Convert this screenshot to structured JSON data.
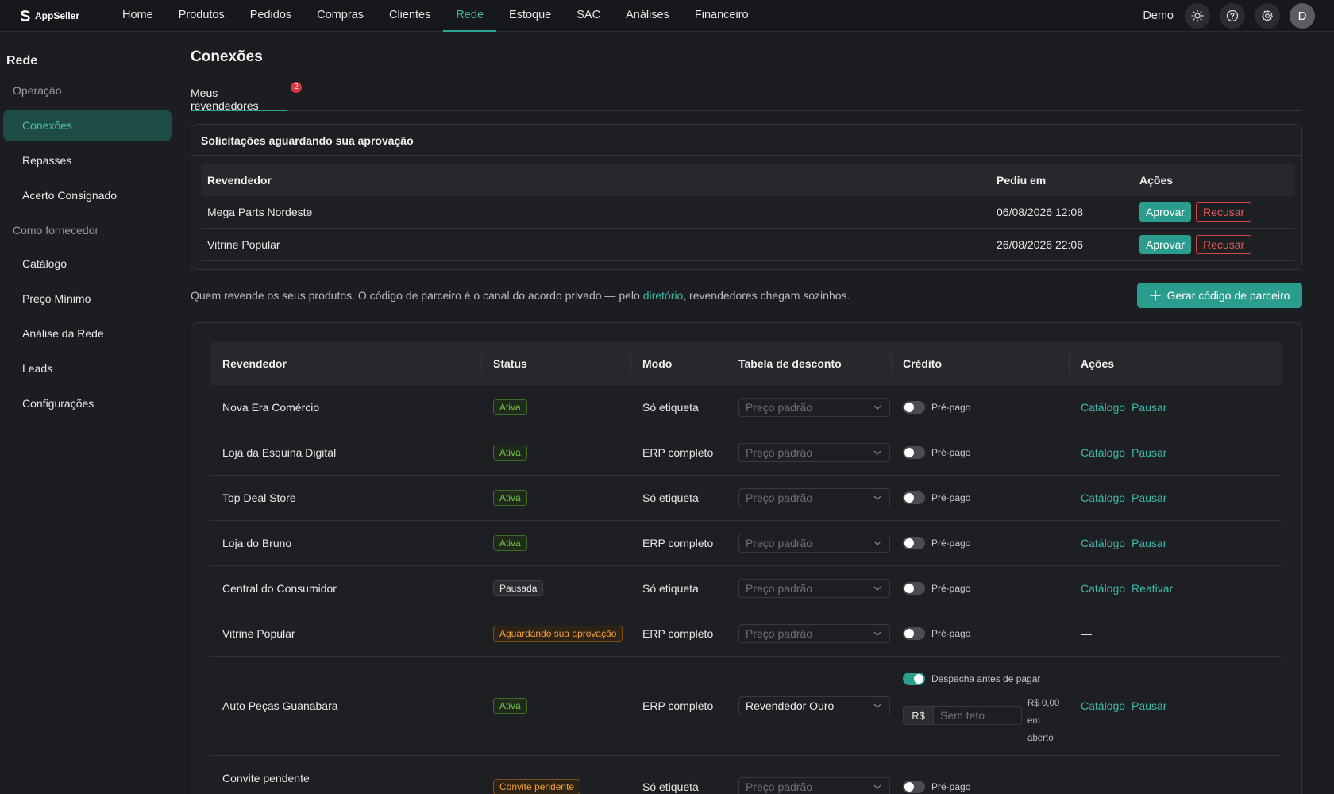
{
  "app": {
    "logo_text": "AppSeller"
  },
  "nav": {
    "items": [
      {
        "label": "Home"
      },
      {
        "label": "Produtos"
      },
      {
        "label": "Pedidos"
      },
      {
        "label": "Compras"
      },
      {
        "label": "Clientes"
      },
      {
        "label": "Rede"
      },
      {
        "label": "Estoque"
      },
      {
        "label": "SAC"
      },
      {
        "label": "Análises"
      },
      {
        "label": "Financeiro"
      }
    ],
    "active": "Rede",
    "user_name": "Demo",
    "avatar_initial": "D",
    "icons": [
      "sun-icon",
      "help-icon",
      "gear-icon"
    ]
  },
  "sidebar": {
    "title": "Rede",
    "section_operacao": "Operação",
    "item_conexoes": "Conexões",
    "item_repasses": "Repasses",
    "item_acerto": "Acerto Consignado",
    "section_fornecedor": "Como fornecedor",
    "item_catalogo": "Catálogo",
    "item_preco": "Preço Mínimo",
    "item_analise": "Análise da Rede",
    "item_leads": "Leads",
    "item_config": "Configurações"
  },
  "page": {
    "title": "Conexões",
    "tab_label": "Meus revendedores",
    "tab_badge": "2"
  },
  "requests": {
    "title": "Solicitações aguardando sua aprovação",
    "headers": {
      "reseller": "Revendedor",
      "requested": "Pediu em",
      "actions": "Ações"
    },
    "approve_label": "Aprovar",
    "refuse_label": "Recusar",
    "rows": [
      {
        "name": "Mega Parts Nordeste",
        "date": "06/08/2026 12:08"
      },
      {
        "name": "Vitrine Popular",
        "date": "26/08/2026 22:06"
      }
    ]
  },
  "info": {
    "text_before": "Quem revende os seus produtos. O código de parceiro é o canal do acordo privado — pelo ",
    "link": "diretório",
    "text_after": ", revendedores chegam sozinhos.",
    "button": "Gerar código de parceiro"
  },
  "resellers": {
    "headers": {
      "reseller": "Revendedor",
      "status": "Status",
      "mode": "Modo",
      "discount": "Tabela de desconto",
      "credit": "Crédito",
      "actions": "Ações"
    },
    "credit_prepaid": "Pré-pago",
    "credit_ship_before": "Despacha antes de pagar",
    "credit_prefix": "R$",
    "credit_placeholder": "Sem teto",
    "credit_open_amount": "R$ 0,00",
    "credit_open_word1": "em",
    "credit_open_word2": "aberto",
    "discount_placeholder": "Preço padrão",
    "action_catalog": "Catálogo",
    "action_pause": "Pausar",
    "action_reactivate": "Reativar",
    "action_none": "—",
    "rows": [
      {
        "name": "Nova Era Comércio",
        "status": "Ativa",
        "status_kind": "green",
        "mode": "Só etiqueta"
      },
      {
        "name": "Loja da Esquina Digital",
        "status": "Ativa",
        "status_kind": "green",
        "mode": "ERP completo"
      },
      {
        "name": "Top Deal Store",
        "status": "Ativa",
        "status_kind": "green",
        "mode": "Só etiqueta"
      },
      {
        "name": "Loja do Bruno",
        "status": "Ativa",
        "status_kind": "green",
        "mode": "ERP completo"
      },
      {
        "name": "Central do Consumidor",
        "status": "Pausada",
        "status_kind": "gray",
        "mode": "Só etiqueta"
      },
      {
        "name": "Vitrine Popular",
        "status": "Aguardando sua aprovação",
        "status_kind": "orange",
        "mode": "ERP completo"
      },
      {
        "name": "Auto Peças Guanabara",
        "status": "Ativa",
        "status_kind": "green",
        "mode": "ERP completo",
        "discount": "Revendedor Ouro"
      },
      {
        "name": "Convite pendente",
        "status": "Convite pendente",
        "status_kind": "orange",
        "mode": "Só etiqueta"
      }
    ]
  },
  "colors": {
    "accent": "#2a9d8f",
    "danger": "#d9363e",
    "warning": "#f0a03c",
    "success": "#74c84a"
  }
}
